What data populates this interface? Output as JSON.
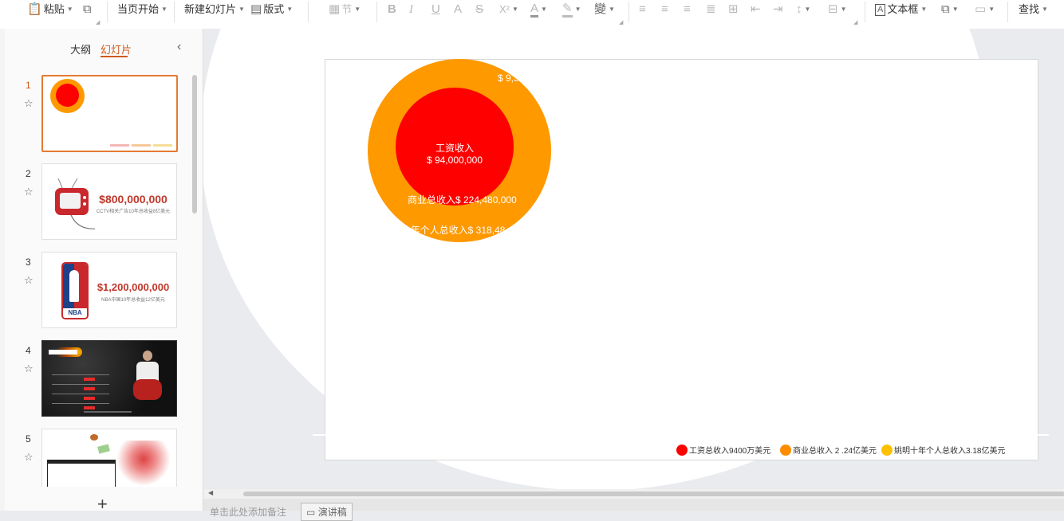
{
  "toolbar": {
    "paste": "粘贴",
    "from_current": "当页开始",
    "new_slide": "新建幻灯片",
    "layout": "版式",
    "section": "节",
    "superscript": "X²",
    "text_box": "文本框",
    "find": "查找"
  },
  "panel": {
    "tab_outline": "大纲",
    "tab_slides": "幻灯片",
    "slide_numbers": [
      "1",
      "2",
      "3",
      "4",
      "5"
    ],
    "thumb2_text": "$800,000,000",
    "thumb2_sub": "CCTV相关广告10年总收益8亿美元",
    "thumb3_text": "$1,200,000,000",
    "thumb3_sub": "NBA中国10年总收益12亿美元",
    "thumb3_logo": "NBA"
  },
  "slide": {
    "center_label_1": "工资收入",
    "center_label_2": "$ 94,000,000",
    "outer_top_label": "$ 9,3",
    "commercial_label": "商业总收入$ 224,480,000",
    "total_label": "0年个人总收入$ 318,48",
    "legend": [
      {
        "label": "工资总收入9400万美元",
        "color": "#ff0000"
      },
      {
        "label": "商业总收入 2 .24亿美元",
        "color": "#ff8c00"
      },
      {
        "label": "姚明十年个人总收入3.18亿美元",
        "color": "#ffc000"
      }
    ]
  },
  "notes": {
    "placeholder": "单击此处添加备注",
    "speech": "演讲稿"
  }
}
